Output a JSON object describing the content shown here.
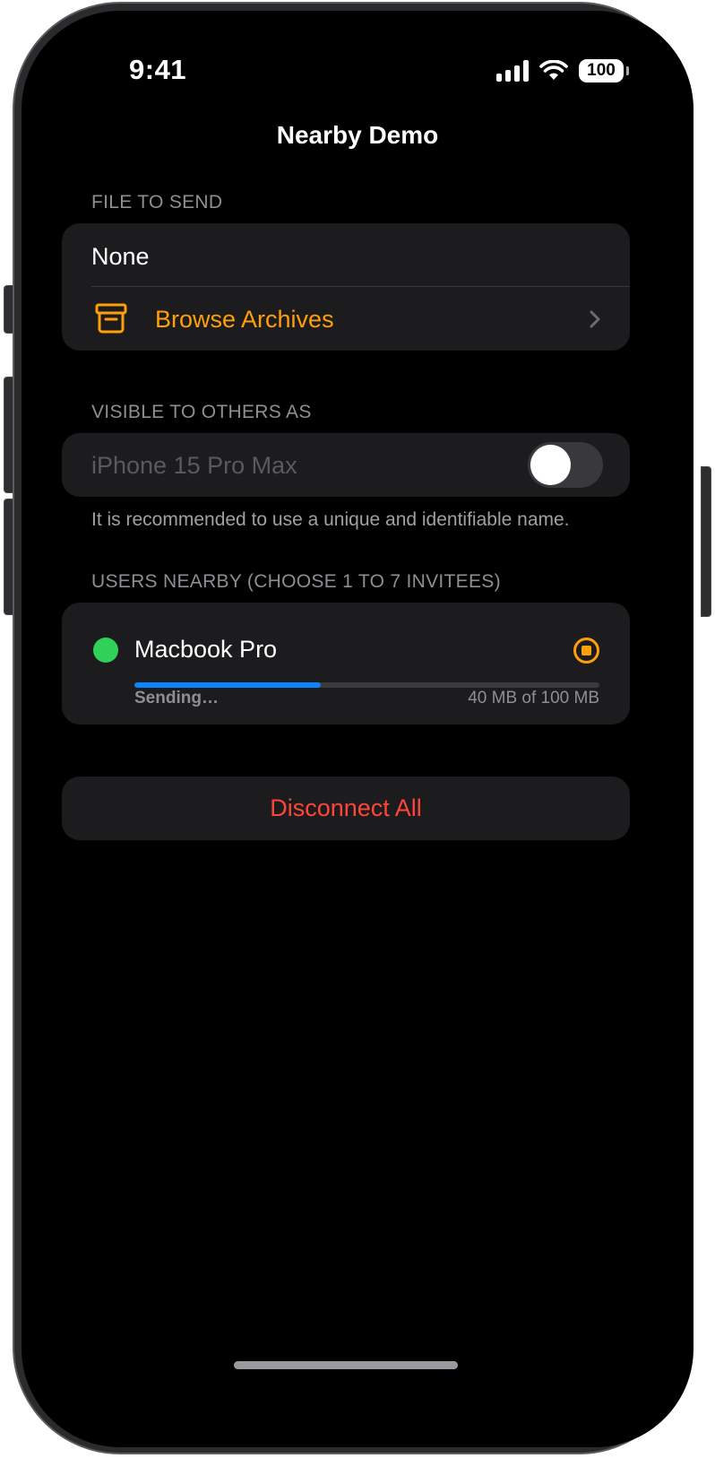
{
  "status_bar": {
    "time": "9:41",
    "battery": "100"
  },
  "nav": {
    "title": "Nearby Demo"
  },
  "file_section": {
    "header": "FILE TO SEND",
    "selected_file": "None",
    "browse_label": "Browse Archives",
    "icon": "archive-box-icon"
  },
  "visible_section": {
    "header": "VISIBLE TO OTHERS AS",
    "device_name": "iPhone 15 Pro Max",
    "toggle_on": false,
    "footer": "It is recommended to use a unique and identifiable name."
  },
  "users_section": {
    "header": "USERS NEARBY (CHOOSE 1 TO 7 INVITEES)",
    "users": [
      {
        "name": "Macbook Pro",
        "status_color": "#30d158",
        "status": "Sending…",
        "transfer": "40 MB of 100 MB",
        "progress": 0.4
      }
    ]
  },
  "actions": {
    "disconnect_all": "Disconnect All"
  },
  "colors": {
    "accent": "#ff9f0a",
    "destructive": "#ff453a",
    "progress": "#0a84ff",
    "online": "#30d158"
  }
}
